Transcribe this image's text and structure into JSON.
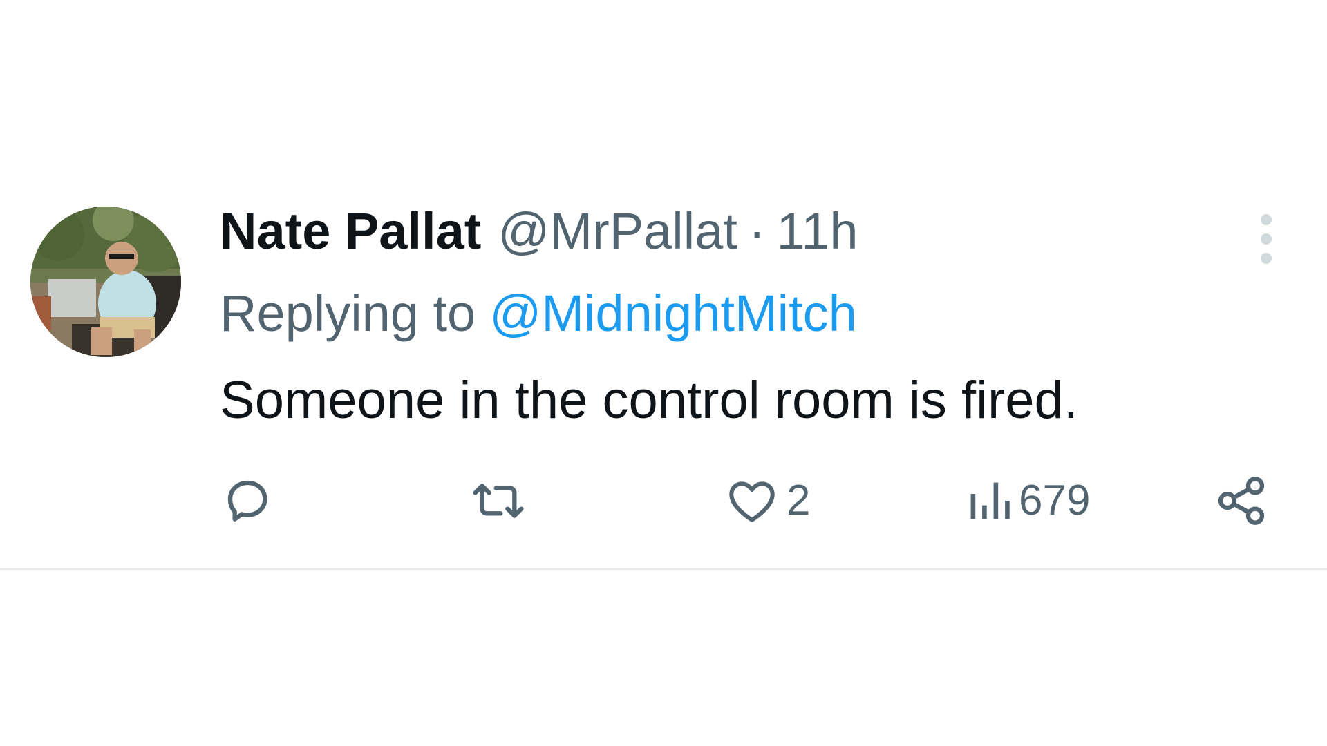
{
  "tweet": {
    "author": {
      "display_name": "Nate Pallat",
      "handle": "@MrPallat",
      "separator": "·",
      "timestamp": "11h"
    },
    "reply": {
      "prefix": "Replying to",
      "target": "@MidnightMitch"
    },
    "text": "Someone in the control room is fired.",
    "actions": {
      "reply_icon": "reply-bubble-icon",
      "retweet_icon": "retweet-icon",
      "like_icon": "heart-icon",
      "like_count": "2",
      "views_icon": "views-bar-chart-icon",
      "views_count": "679",
      "share_icon": "share-icon"
    },
    "more_icon": "vertical-ellipsis-icon"
  },
  "colors": {
    "text_primary": "#0f1419",
    "text_secondary": "#536471",
    "link": "#1d9bf0",
    "divider": "#e6e9ec",
    "more_dots": "#cfd9de"
  }
}
